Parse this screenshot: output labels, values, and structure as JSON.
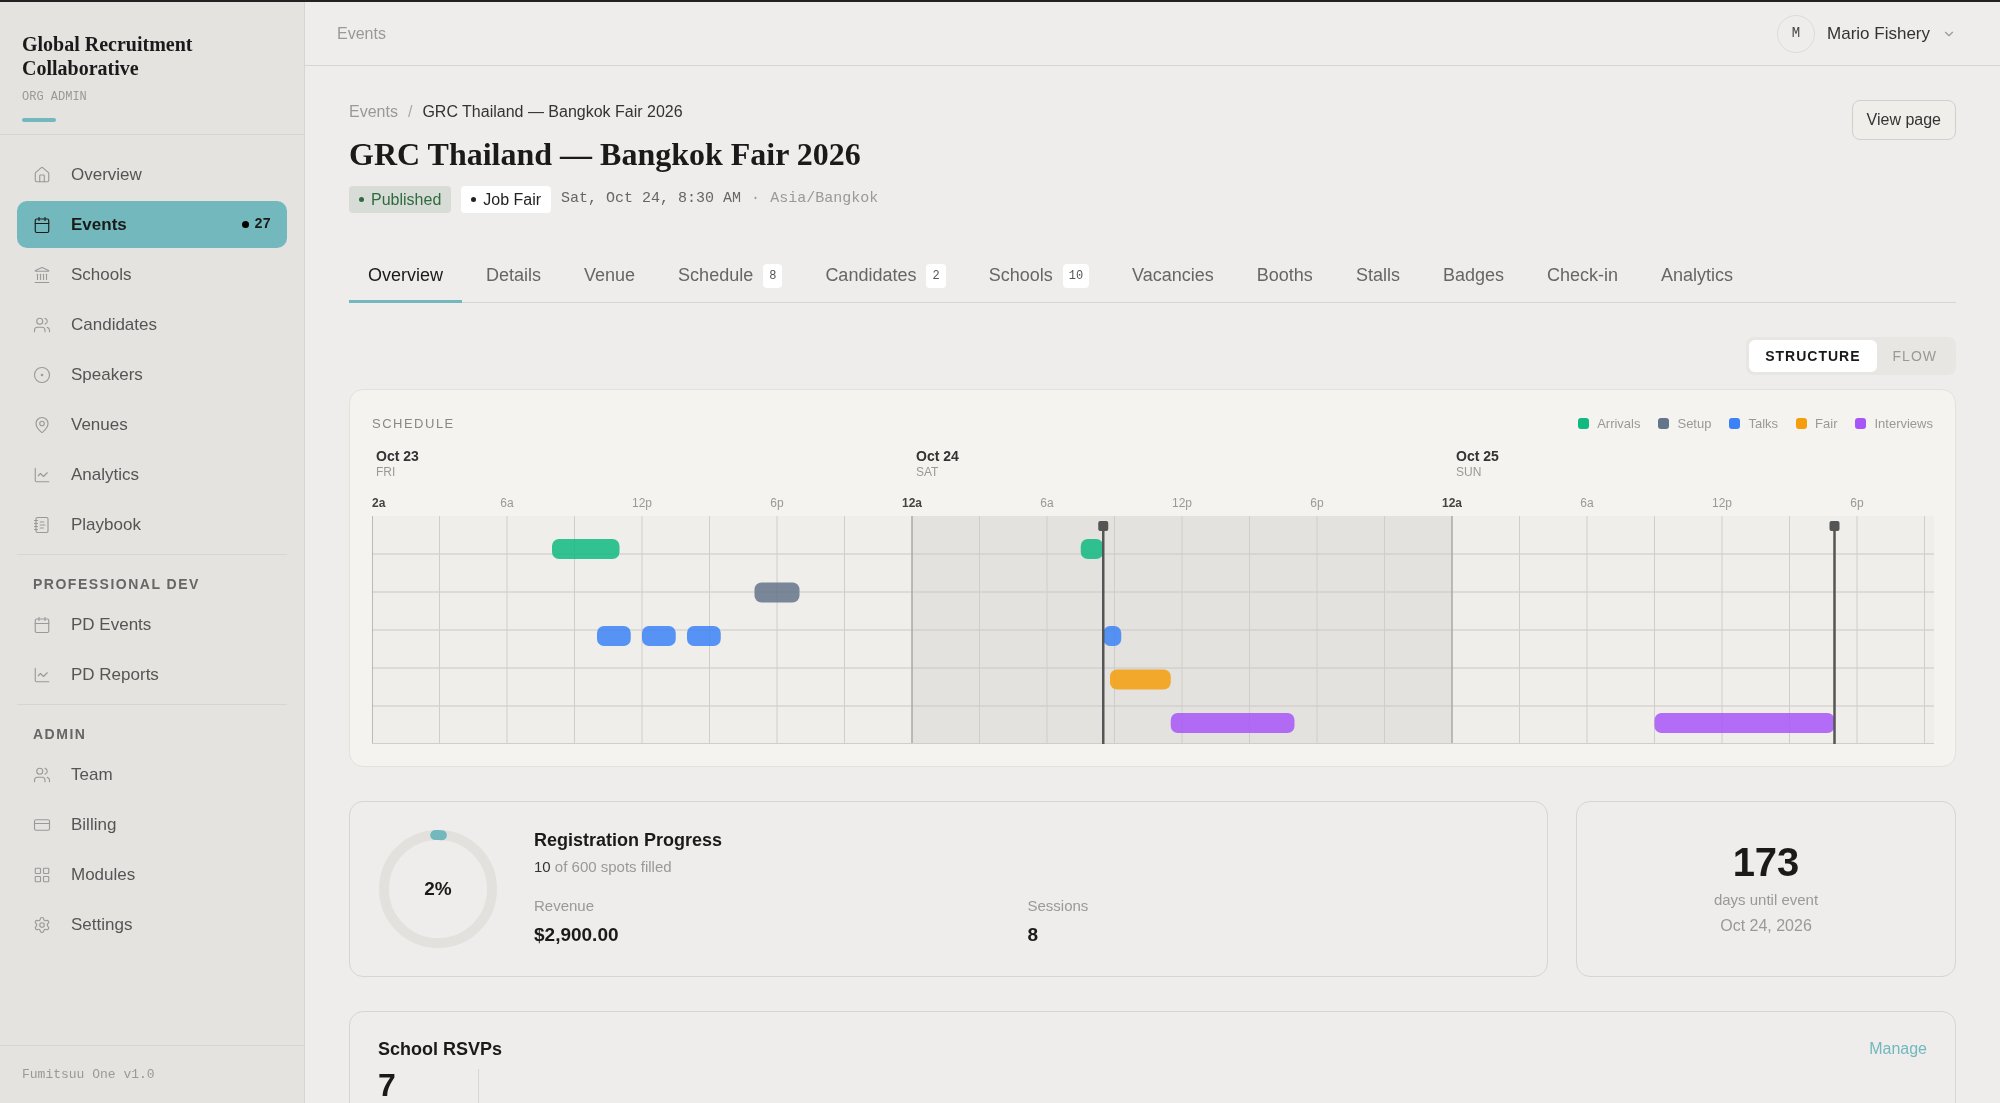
{
  "sidebar": {
    "org_name": "Global Recruitment Collaborative",
    "role": "ORG ADMIN",
    "groups": [
      {
        "items": [
          {
            "label": "Overview",
            "selected": false
          },
          {
            "label": "Events",
            "selected": true,
            "count": "27"
          },
          {
            "label": "Schools",
            "selected": false
          },
          {
            "label": "Candidates",
            "selected": false
          },
          {
            "label": "Speakers",
            "selected": false
          },
          {
            "label": "Venues",
            "selected": false
          },
          {
            "label": "Analytics",
            "selected": false
          },
          {
            "label": "Playbook",
            "selected": false
          }
        ]
      },
      {
        "heading": "PROFESSIONAL DEV",
        "items": [
          {
            "label": "PD Events",
            "selected": false
          },
          {
            "label": "PD Reports",
            "selected": false
          }
        ]
      },
      {
        "heading": "ADMIN",
        "items": [
          {
            "label": "Team",
            "selected": false
          },
          {
            "label": "Billing",
            "selected": false
          },
          {
            "label": "Modules",
            "selected": false
          },
          {
            "label": "Settings",
            "selected": false
          }
        ]
      }
    ],
    "footer": "Fumitsuu One v1.0"
  },
  "topbar": {
    "section": "Events",
    "user": {
      "initial": "M",
      "name": "Mario Fishery"
    }
  },
  "breadcrumb": {
    "items": [
      "Events",
      "GRC Thailand — Bangkok Fair 2026"
    ],
    "separator": "/"
  },
  "title": "GRC Thailand — Bangkok Fair 2026",
  "status_badge": "Published",
  "type_badge": "Job Fair",
  "date": "Sat, Oct 24, 8:30 AM",
  "date_separator": "·",
  "timezone": "Asia/Bangkok",
  "view_button": "View page",
  "tabs": [
    {
      "label": "Overview",
      "selected": true
    },
    {
      "label": "Details",
      "selected": false
    },
    {
      "label": "Venue",
      "selected": false
    },
    {
      "label": "Schedule",
      "count": "8",
      "selected": false
    },
    {
      "label": "Candidates",
      "count": "2",
      "selected": false
    },
    {
      "label": "Schools",
      "count": "10",
      "selected": false
    },
    {
      "label": "Vacancies",
      "selected": false
    },
    {
      "label": "Booths",
      "selected": false
    },
    {
      "label": "Stalls",
      "selected": false
    },
    {
      "label": "Badges",
      "selected": false
    },
    {
      "label": "Check-in",
      "selected": false
    },
    {
      "label": "Analytics",
      "selected": false
    }
  ],
  "view_toggle": [
    {
      "label": "STRUCTURE",
      "selected": true
    },
    {
      "label": "FLOW",
      "selected": false
    }
  ],
  "schedule": {
    "title": "SCHEDULE",
    "legend": [
      {
        "label": "Arrivals",
        "color": "#10b981"
      },
      {
        "label": "Setup",
        "color": "#64748b"
      },
      {
        "label": "Talks",
        "color": "#3b82f6"
      },
      {
        "label": "Fair",
        "color": "#f59e0b"
      },
      {
        "label": "Interviews",
        "color": "#a855f7"
      }
    ],
    "days": [
      {
        "date": "Oct 23",
        "weekday": "FRI"
      },
      {
        "date": "Oct 24",
        "weekday": "SAT"
      },
      {
        "date": "Oct 25",
        "weekday": "SUN"
      }
    ],
    "ticks": [
      "2a",
      "6a",
      "12p",
      "6p",
      "12a",
      "6a",
      "12p",
      "6p",
      "12a",
      "6a",
      "12p",
      "6p"
    ]
  },
  "registration": {
    "percent": "2%",
    "level": 0.02,
    "title": "Registration Progress",
    "filled": "10",
    "of_text": "of 600 spots filled",
    "stats": [
      {
        "label": "Revenue",
        "value": "$2,900.00"
      },
      {
        "label": "Sessions",
        "value": "8"
      }
    ]
  },
  "countdown": {
    "value": "173",
    "label": "days until event",
    "date": "Oct 24, 2026"
  },
  "rsvps": {
    "title": "School RSVPs",
    "action": "Manage",
    "count": "7"
  }
}
